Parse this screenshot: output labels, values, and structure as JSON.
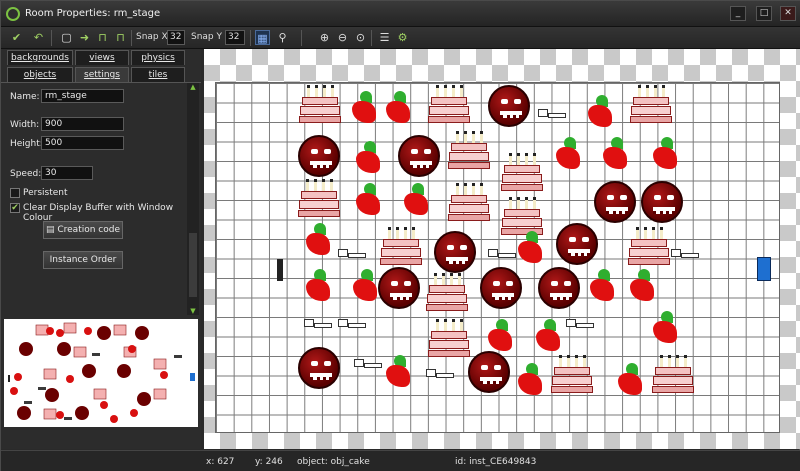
{
  "window": {
    "title": "Room Properties: rm_stage",
    "minimize": "_",
    "maximize": "□",
    "close": "✕"
  },
  "toolbar": {
    "snapx_label": "Snap X",
    "snapx_value": "32",
    "snapy_label": "Snap Y",
    "snapy_value": "32",
    "icons": [
      "check-icon",
      "undo-icon",
      "save-icon",
      "arrow-right-icon",
      "lock-icon",
      "unlock-icon",
      "grid-toggle-icon",
      "zoom-icon",
      "zoom-in-icon",
      "zoom-out-icon",
      "zoom-reset-icon",
      "list-icon",
      "settings-icon"
    ]
  },
  "tabs": {
    "row1": [
      "backgrounds",
      "views",
      "physics"
    ],
    "row2": [
      "objects",
      "settings",
      "tiles"
    ],
    "active": "settings"
  },
  "settings": {
    "name_label": "Name:",
    "name_value": "rm_stage",
    "width_label": "Width:",
    "width_value": "900",
    "height_label": "Height:",
    "height_value": "500",
    "speed_label": "Speed:",
    "speed_value": "30",
    "persistent_label": "Persistent",
    "persistent_checked": false,
    "clear_label": "Clear Display Buffer with Window Colour",
    "clear_checked": true,
    "creation_code_button": "Creation code",
    "instance_order_button": "Instance Order"
  },
  "status": {
    "x": "x: 627",
    "y": "y: 246",
    "object": "object: obj_cake",
    "id": "id: inst_CE649843"
  },
  "colors": {
    "accent": "#7cc242",
    "background": "#2a2a2a"
  }
}
